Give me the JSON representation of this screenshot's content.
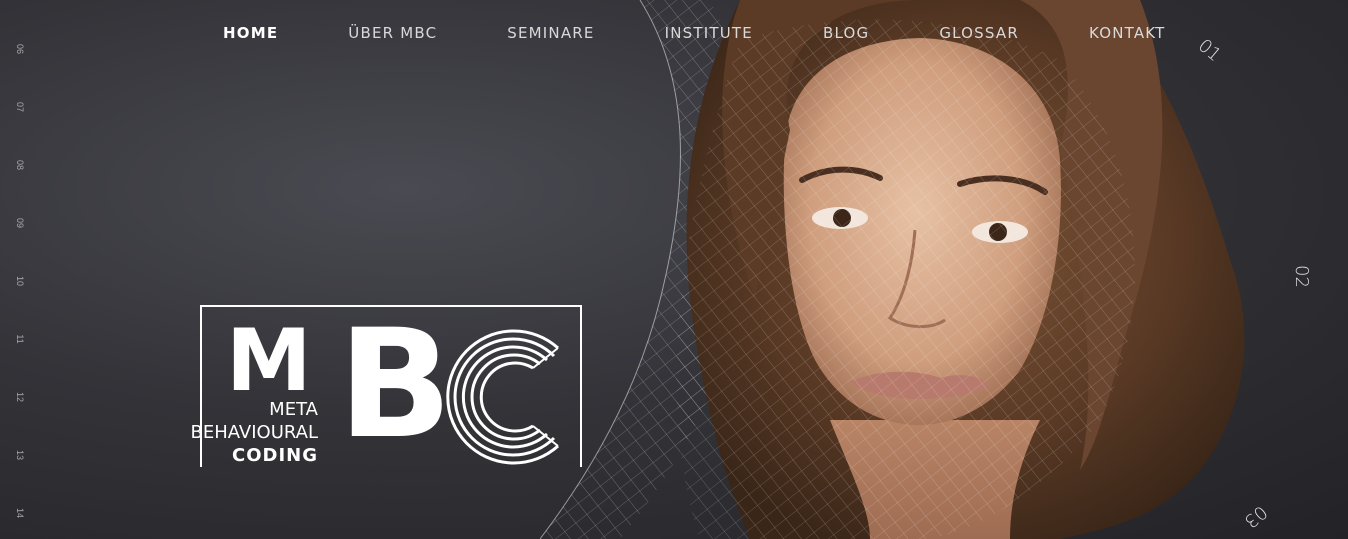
{
  "nav": {
    "items": [
      {
        "label": "HOME",
        "active": true
      },
      {
        "label": "ÜBER MBC"
      },
      {
        "label": "SEMINARE"
      },
      {
        "label": "INSTITUTE"
      },
      {
        "label": "BLOG"
      },
      {
        "label": "GLOSSAR"
      },
      {
        "label": "KONTAKT"
      }
    ]
  },
  "ruler": [
    "06",
    "07",
    "08",
    "09",
    "10",
    "11",
    "12",
    "13",
    "14"
  ],
  "orbit": [
    "01",
    "02",
    "03"
  ],
  "logo": {
    "letters_m": "M",
    "letters_b": "B",
    "line1": "META",
    "line2": "BEHAVIOURAL",
    "line3": "CODING"
  },
  "colors": {
    "background": "#2c2c31",
    "text": "#ffffff",
    "nav_inactive": "#d9d9d9"
  }
}
